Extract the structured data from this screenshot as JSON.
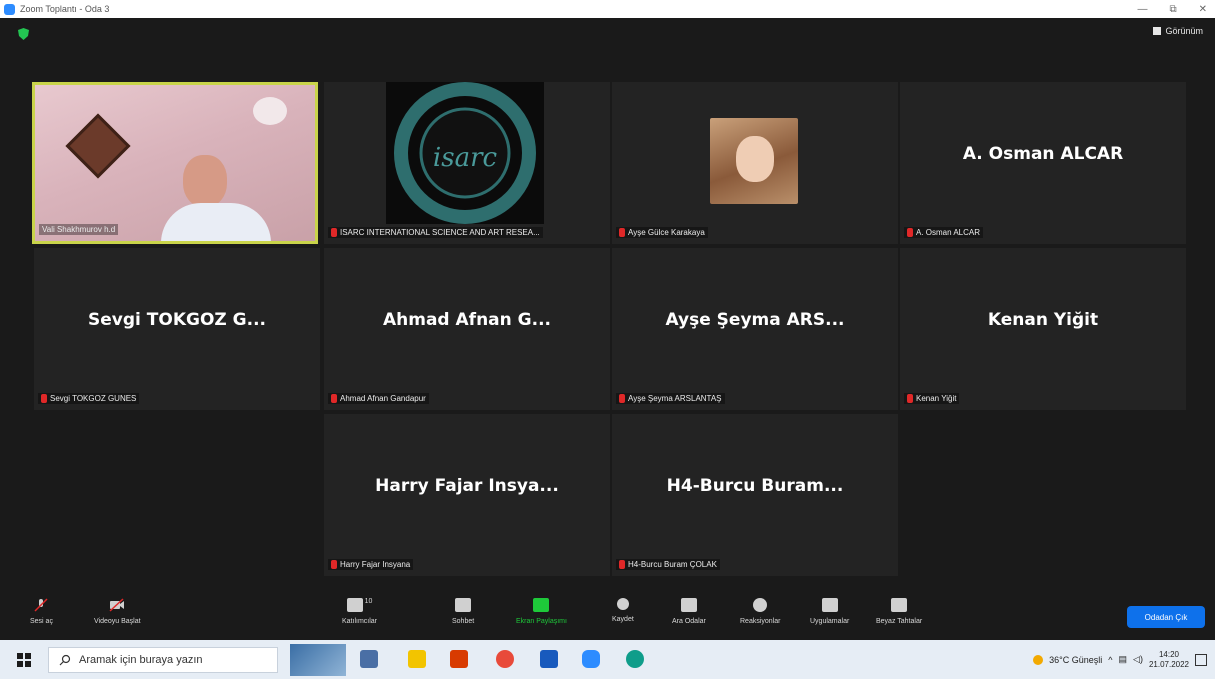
{
  "window": {
    "title": "Zoom Toplantı - Oda 3",
    "controls": [
      "—",
      "⧉",
      "✕"
    ]
  },
  "header": {
    "view_label": "Görünüm"
  },
  "tiles": [
    {
      "big_name": "",
      "label": "Vali Shakhmurov h.d",
      "muted": false
    },
    {
      "big_name": "",
      "label": "ISARC INTERNATIONAL SCIENCE AND ART RESEA...",
      "muted": true,
      "logo_text": "isarc"
    },
    {
      "big_name": "",
      "label": "Ayşe Gülce Karakaya",
      "muted": true
    },
    {
      "big_name": "A. Osman ALCAR",
      "label": "A. Osman ALCAR",
      "muted": true
    },
    {
      "big_name": "Sevgi TOKGOZ G...",
      "label": "Sevgi TOKGOZ GUNES",
      "muted": true
    },
    {
      "big_name": "Ahmad Afnan G...",
      "label": "Ahmad Afnan Gandapur",
      "muted": true
    },
    {
      "big_name": "Ayşe Şeyma ARS...",
      "label": "Ayşe Şeyma ARSLANTAŞ",
      "muted": true
    },
    {
      "big_name": "Kenan Yiğit",
      "label": "Kenan Yiğit",
      "muted": true
    },
    {
      "big_name": "Harry Fajar Insya...",
      "label": "Harry Fajar Insyana",
      "muted": true
    },
    {
      "big_name": "H4-Burcu Buram...",
      "label": "H4-Burcu Buram ÇOLAK",
      "muted": true
    }
  ],
  "toolbar": {
    "audio": "Sesi aç",
    "video": "Videoyu Başlat",
    "participants": "Katılımcılar",
    "participants_count": "10",
    "chat": "Sohbet",
    "share": "Ekran Paylaşımı",
    "record": "Kaydet",
    "breakout": "Ara Odalar",
    "reactions": "Reaksiyonlar",
    "apps": "Uygulamalar",
    "whiteboard": "Beyaz Tahtalar",
    "leave": "Odadan Çık"
  },
  "taskbar": {
    "search_placeholder": "Aramak için buraya yazın",
    "weather": "36°C Güneşli",
    "time": "14:20",
    "date": "21.07.2022"
  },
  "colors": {
    "accent_blue": "#0e71eb",
    "active_border": "#c9d44a",
    "share_green": "#1ec93a",
    "muted_red": "#e02828"
  }
}
